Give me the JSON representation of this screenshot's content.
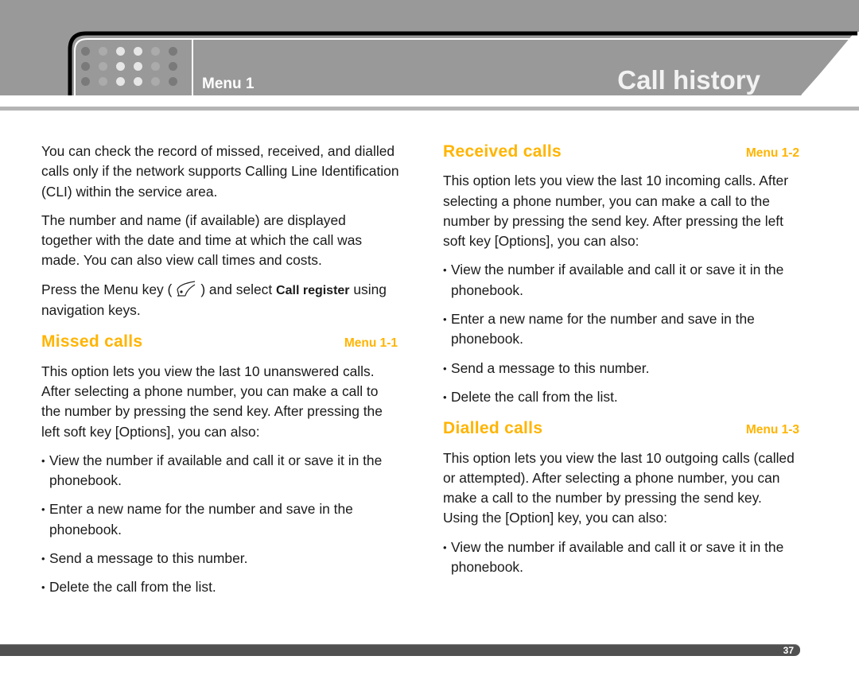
{
  "header": {
    "menu_label": "Menu 1",
    "title": "Call history"
  },
  "colors": {
    "accent": "#ffb400",
    "header_grey": "#999999",
    "footer_bar": "#505050"
  },
  "intro": {
    "para1": "You can check the record of missed, received, and dialled calls only if the network supports Calling Line Identification (CLI) within the service area.",
    "para2": "The number and name (if available) are displayed together with the date and time at which the call was made. You can also view call times and costs.",
    "para3_before": "Press the Menu key (",
    "para3_icon": "menu-key-icon",
    "para3_mid": ") and select ",
    "para3_bold": "Call register",
    "para3_after": " using navigation keys."
  },
  "sections": [
    {
      "title": "Missed calls",
      "menu": "Menu 1-1",
      "body": "This option lets you view the last 10 unanswered calls. After selecting a phone number, you can make a call to the number by pressing the send key. After pressing the left soft key [Options], you can also:",
      "bullets": [
        "View the number if available and call it or save it in the phonebook.",
        "Enter a new name for the number and save in the phonebook.",
        "Send a message to this number.",
        "Delete the call from the list."
      ]
    },
    {
      "title": "Received calls",
      "menu": "Menu 1-2",
      "body": "This option lets you view the last 10 incoming calls. After selecting a phone number, you can make a call to the number by pressing the send key. After pressing the left soft key [Options], you can also:",
      "bullets": [
        "View the number if available and call it or save it in the phonebook.",
        "Enter a new name for the number and save in the phonebook.",
        "Send a message to this number.",
        "Delete the call from the list."
      ]
    },
    {
      "title": "Dialled calls",
      "menu": "Menu 1-3",
      "body": "This option lets you view the last 10 outgoing calls (called or attempted). After selecting a phone number, you can make a call to the number by pressing the send key. Using the [Option] key, you can also:",
      "bullets": [
        "View the number if available and call it or save it in the phonebook."
      ]
    }
  ],
  "footer": {
    "page_number": "37"
  }
}
